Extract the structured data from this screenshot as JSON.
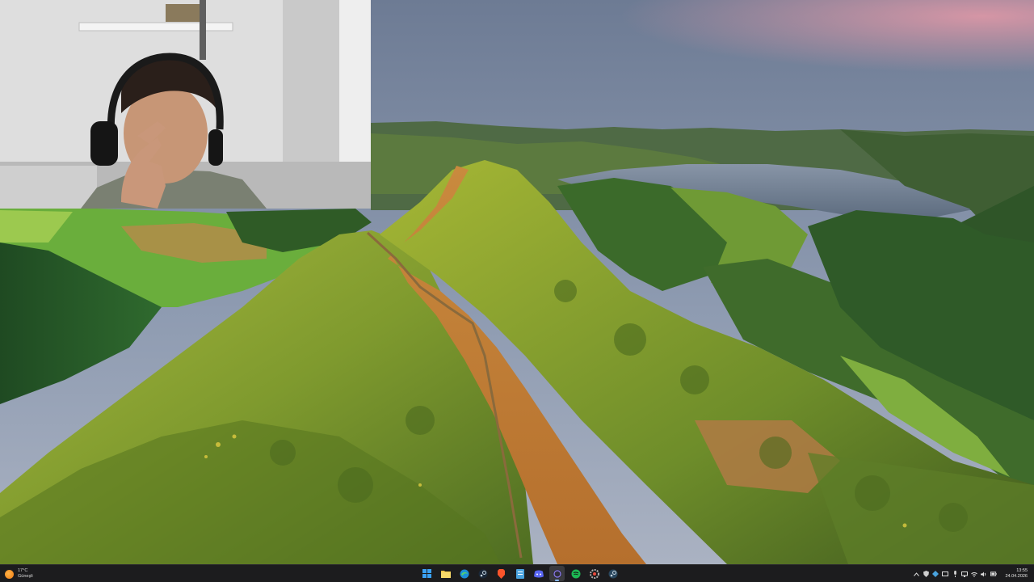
{
  "weather": {
    "temperature": "17°C",
    "condition": "Güneşli"
  },
  "taskbar_apps": [
    {
      "name": "windows-start",
      "icon": "windows-logo-icon"
    },
    {
      "name": "file-explorer",
      "icon": "folder-icon"
    },
    {
      "name": "edge",
      "icon": "edge-icon"
    },
    {
      "name": "steam",
      "icon": "steam-icon"
    },
    {
      "name": "brave",
      "icon": "brave-icon"
    },
    {
      "name": "notepad",
      "icon": "notepad-icon"
    },
    {
      "name": "discord",
      "icon": "discord-icon"
    },
    {
      "name": "obs",
      "icon": "obs-icon"
    },
    {
      "name": "spotify",
      "icon": "spotify-icon"
    },
    {
      "name": "settings",
      "icon": "gear-icon"
    },
    {
      "name": "steam-2",
      "icon": "steam-icon"
    }
  ],
  "system_tray": {
    "icons": [
      "chevron-up-icon",
      "shield-icon",
      "network-icon",
      "display-icon",
      "microphone-icon",
      "monitor-icon",
      "wifi-icon",
      "volume-icon",
      "battery-icon"
    ],
    "time": "13:55",
    "date": "24.04.2026"
  },
  "colors": {
    "taskbar_bg": "#1c1c1e",
    "accent": "#86b7ff"
  }
}
